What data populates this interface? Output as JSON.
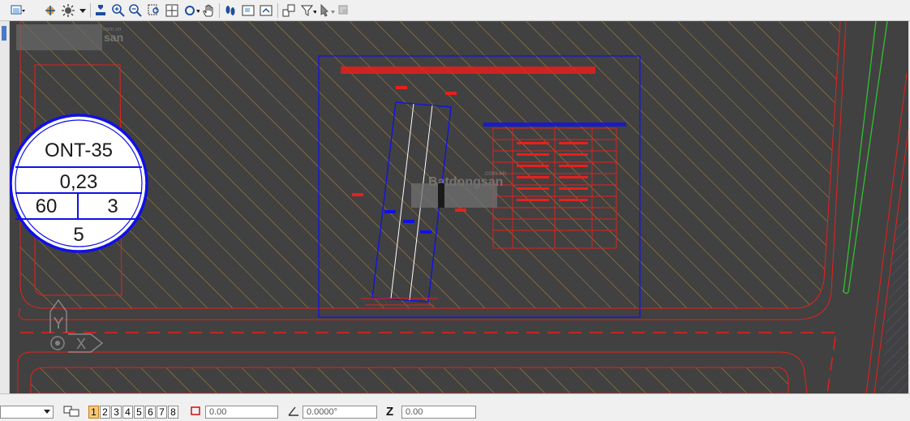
{
  "toolbar": {
    "icons": [
      "layer-menu-icon",
      "snap-icon",
      "lightbulb-icon",
      "mask-icon",
      "zoom-in-icon",
      "zoom-out-icon",
      "zoom-window-icon",
      "fit-view-icon",
      "rotate-view-icon",
      "pan-hand-icon",
      "footprints-icon",
      "view-box-icon",
      "view-previous-icon",
      "view-attributes-icon",
      "fence-filter-icon",
      "select-tool-icon",
      "measure-icon"
    ]
  },
  "drawing": {
    "parcel_code": "ONT-35",
    "area_value": "0,23",
    "left_value": "60",
    "right_value": "3",
    "bottom_value": "5",
    "watermark_main": "Batdongsan",
    "watermark_sub": ".com.vn",
    "watermark_corner": "san",
    "watermark_corner_sub": "com.vn",
    "axis_y": "Y",
    "axis_x": "X",
    "colors": {
      "background": "#414141",
      "hatch": "#b88a36",
      "blue": "#1010e8",
      "red": "#e8201c",
      "green": "#30c030"
    }
  },
  "status": {
    "pages": [
      "1",
      "2",
      "3",
      "4",
      "5",
      "6",
      "7",
      "8"
    ],
    "active_page": "1",
    "coord_value": "0.00",
    "angle_value": "0.0000°",
    "z_label": "Z",
    "z_value": "0.00"
  }
}
